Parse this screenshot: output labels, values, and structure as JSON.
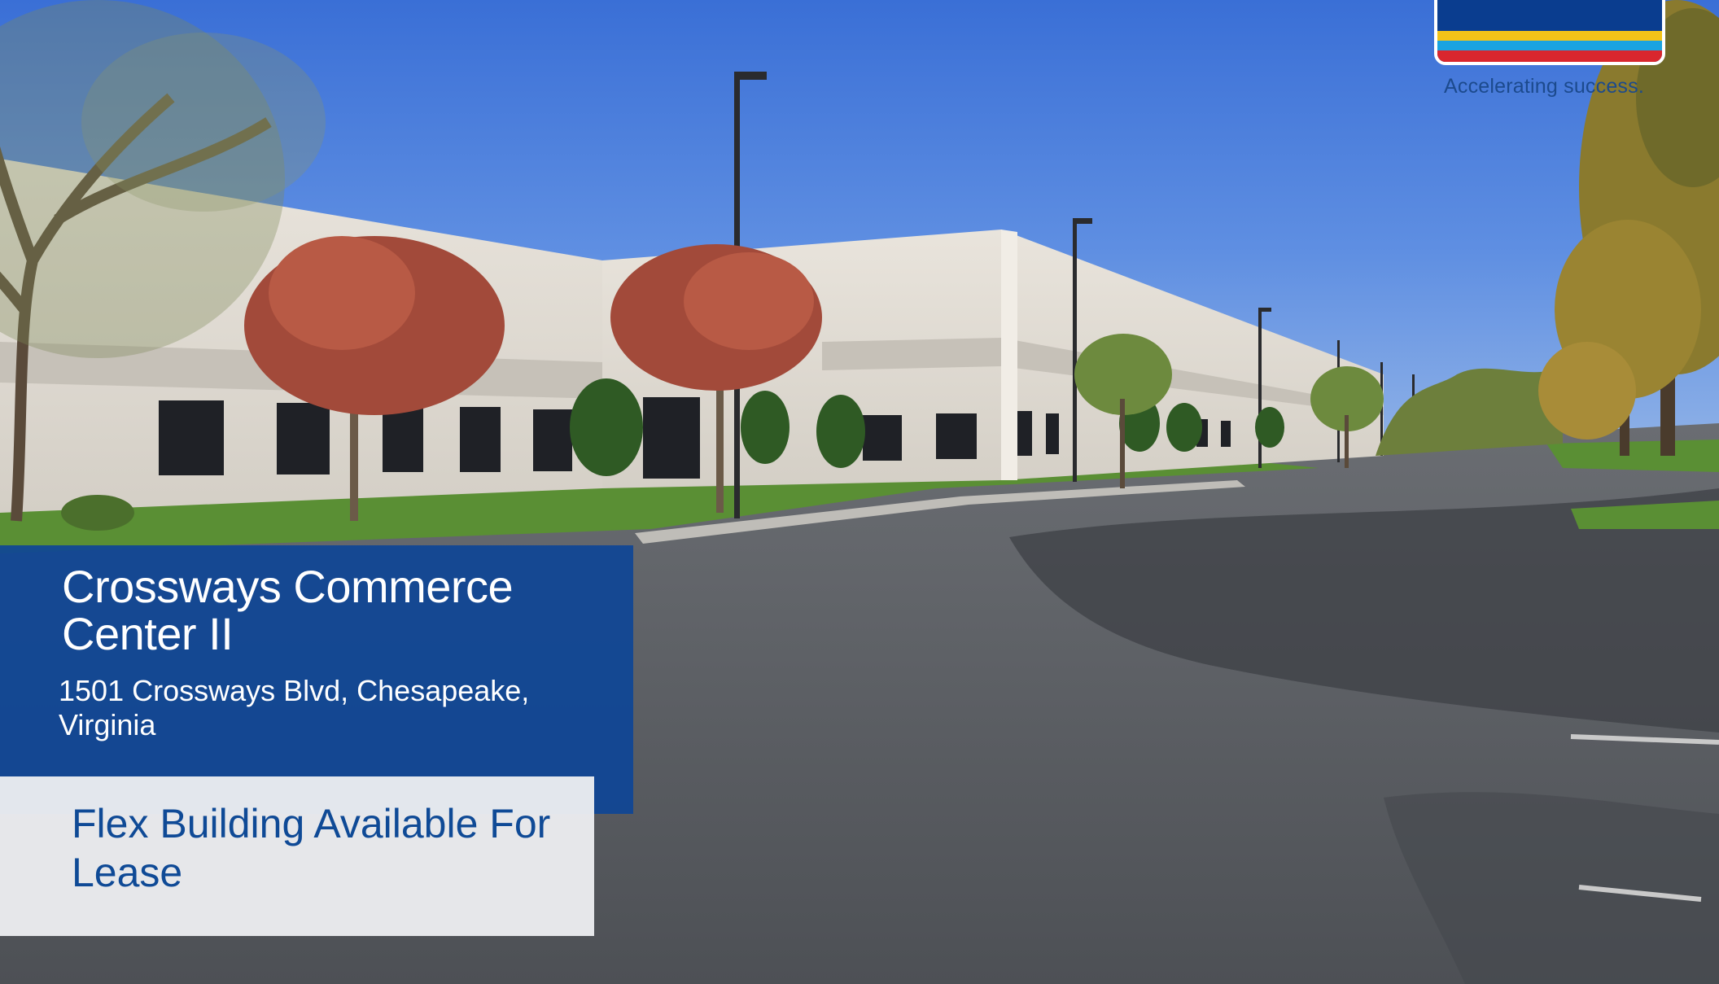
{
  "brand": {
    "tagline": "Accelerating success.",
    "logo_colors": {
      "navy": "#0a3d8f",
      "yellow": "#f2c318",
      "blue": "#1aa3e0",
      "red": "#d9262e"
    }
  },
  "property": {
    "title": "Crossways Commerce Center II",
    "address": "1501 Crossways Blvd, Chesapeake, Virginia",
    "headline": "Flex Building Available For Lease"
  },
  "colors": {
    "title_panel": "#0f4696",
    "headline_panel": "#ecedf0",
    "headline_text": "#0f4a96"
  },
  "icons": {
    "logo": "colliers-logo-icon",
    "photo": "building-photo"
  }
}
